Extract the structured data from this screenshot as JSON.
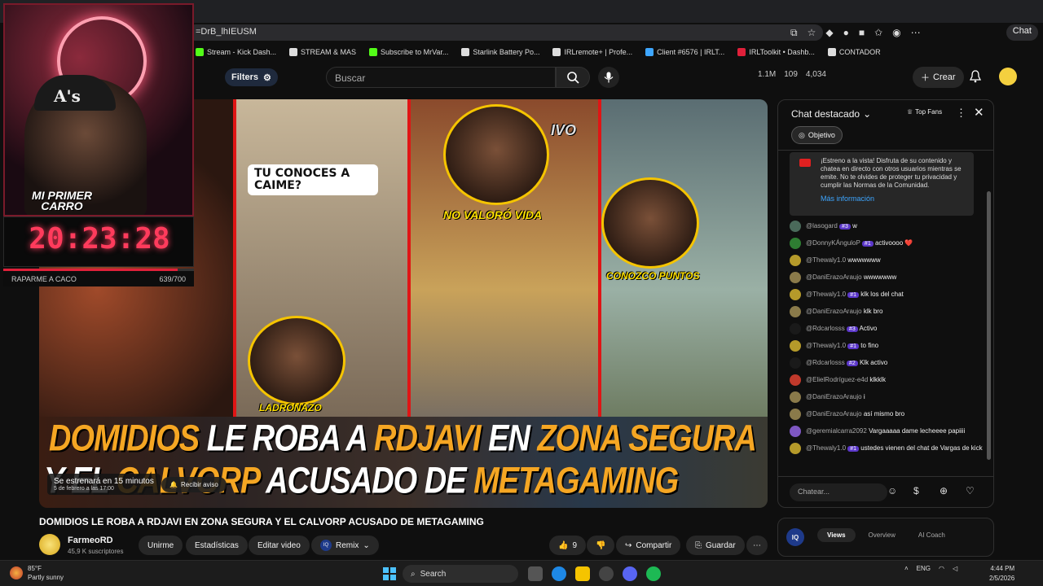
{
  "browser": {
    "url_fragment": "=DrB_lhIEUSM",
    "chat_button": "Chat",
    "bookmarks": [
      {
        "label": "Stream - Kick Dash...",
        "color": "#53fc18"
      },
      {
        "label": "STREAM & MAS",
        "color": "#dddddd"
      },
      {
        "label": "Subscribe to MrVar...",
        "color": "#53fc18"
      },
      {
        "label": "Starlink Battery Po...",
        "color": "#dddddd"
      },
      {
        "label": "IRLremote+ | Profe...",
        "color": "#dddddd"
      },
      {
        "label": "Client #6576 | IRLT...",
        "color": "#3ea6ff"
      },
      {
        "label": "IRLToolkit • Dashb...",
        "color": "#e0203a"
      },
      {
        "label": "CONTADOR",
        "color": "#dddddd"
      }
    ]
  },
  "header": {
    "filters_label": "Filters",
    "search_placeholder": "Buscar",
    "stats": [
      "1.1M",
      "109",
      "4,034"
    ],
    "create_label": "Crear"
  },
  "video": {
    "bubble_text": "TU CONOCES A CAIME?",
    "tag_no_valoro": "NO VALORÓ VIDA",
    "tag_conozco": "CONOZCO PUNTOS",
    "tag_ladronazo": "LADRONAZO",
    "tag_ivo": "IVO",
    "headline_line1": [
      {
        "text": "DOMIDIOS ",
        "accent": true
      },
      {
        "text": "LE ROBA A ",
        "accent": false
      },
      {
        "text": "RDJAVI",
        "accent": true
      },
      {
        "text": " EN ",
        "accent": false
      },
      {
        "text": "ZONA SEGURA",
        "accent": true
      }
    ],
    "headline_line2": [
      {
        "text": "Y EL ",
        "accent": false
      },
      {
        "text": "CALVORP",
        "accent": true
      },
      {
        "text": " ACUSADO DE ",
        "accent": false
      },
      {
        "text": "METAGAMING",
        "accent": true
      }
    ],
    "premiere_line1": "Se estrenará en 15 minutos",
    "premiere_line2": "5 de febrero a las 17:00",
    "notify_label": "Recibir aviso"
  },
  "meta": {
    "title": "DOMIDIOS LE ROBA A RDJAVI EN ZONA SEGURA Y EL CALVORP ACUSADO DE METAGAMING",
    "channel": "FarmeoRD",
    "subscribers": "45,9 K suscriptores",
    "join_label": "Unirme",
    "stats_label": "Estadísticas",
    "edit_label": "Editar video",
    "remix_label": "Remix",
    "likes": "9",
    "share_label": "Compartir",
    "save_label": "Guardar"
  },
  "webcam": {
    "cap_logo": "A's",
    "banner": "MI PRIMER CARRO",
    "timer": "20:23:28",
    "goal_label": "RAPARME A CACO",
    "goal_count": "639/700",
    "goal_progress": 0.913
  },
  "chat": {
    "title": "Chat destacado",
    "top_fans": "Top Fans",
    "objetivo": "Objetivo",
    "notice": "¡Estreno a la vista! Disfruta de su contenido y chatea en directo con otros usuarios mientras se emite. No te olvides de proteger tu privacidad y cumplir las Normas de la Comunidad.",
    "notice_link": "Más información",
    "input_placeholder": "Chatear...",
    "messages": [
      {
        "user": "@lasogard",
        "badge": "#3",
        "text": "w",
        "color": "#4a6a5a"
      },
      {
        "user": "@DonnyKÁnguloP",
        "badge": "#1",
        "text": "activoooo ❤️",
        "color": "#2e7d32"
      },
      {
        "user": "@Thewaly1.0",
        "badge": "",
        "text": "wwwwwww",
        "color": "#b59a2a"
      },
      {
        "user": "@DaniErazoAraujo",
        "badge": "",
        "text": "wwwwwww",
        "color": "#8a7a4a"
      },
      {
        "user": "@Thewaly1.0",
        "badge": "#1",
        "text": "klk los del chat",
        "color": "#b59a2a"
      },
      {
        "user": "@DaniErazoAraujo",
        "badge": "",
        "text": "klk bro",
        "color": "#8a7a4a"
      },
      {
        "user": "@Rdcarlosss",
        "badge": "#3",
        "text": "Activo",
        "color": "#1a1a1a"
      },
      {
        "user": "@Thewaly1.0",
        "badge": "#1",
        "text": "to fino",
        "color": "#b59a2a"
      },
      {
        "user": "@Rdcarlosss",
        "badge": "#2",
        "text": "Klk activo",
        "color": "#1a1a1a"
      },
      {
        "user": "@ElielRodríguez-e4d",
        "badge": "",
        "text": "klkklk",
        "color": "#c0392b"
      },
      {
        "user": "@DaniErazoAraujo",
        "badge": "",
        "text": "i",
        "color": "#8a7a4a"
      },
      {
        "user": "@DaniErazoAraujo",
        "badge": "",
        "text": "así mismo bro",
        "color": "#8a7a4a"
      },
      {
        "user": "@geremialcarra2092",
        "badge": "",
        "text": "Vargaaaaa dame lecheeee papiiii",
        "color": "#7e57c2"
      },
      {
        "user": "@Thewaly1.0",
        "badge": "#1",
        "text": "ustedes vienen del chat de Vargas de kick",
        "color": "#b59a2a"
      }
    ]
  },
  "bottom_panel": {
    "logo": "IQ",
    "tabs": [
      "Views",
      "Overview",
      "AI Coach"
    ]
  },
  "taskbar": {
    "temperature": "85°F",
    "condition": "Partly sunny",
    "search": "Search",
    "lang": "ENG",
    "time": "4:44 PM",
    "date": "2/5/2026"
  }
}
